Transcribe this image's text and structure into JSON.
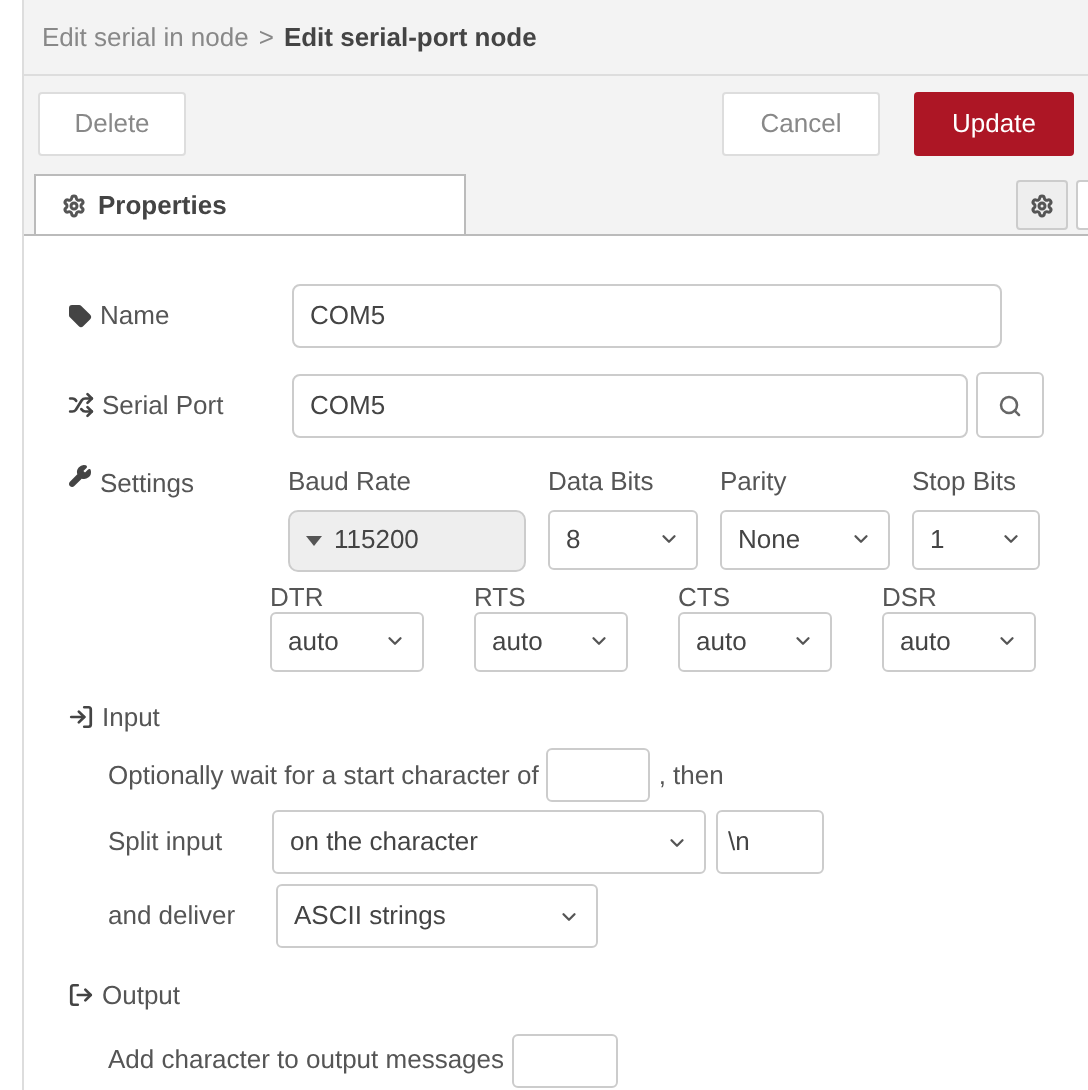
{
  "breadcrumb": {
    "parent": "Edit serial in node",
    "separator": ">",
    "current": "Edit serial-port node"
  },
  "toolbar": {
    "delete": "Delete",
    "cancel": "Cancel",
    "update": "Update"
  },
  "tabs": [
    {
      "label": "Properties",
      "selected": true
    }
  ],
  "name": {
    "label": "Name",
    "value": "COM5"
  },
  "serial_port": {
    "label": "Serial Port",
    "value": "COM5"
  },
  "settings": {
    "label": "Settings",
    "options": [
      {
        "label": "Baud Rate",
        "value": "115200",
        "kind": "combo"
      },
      {
        "label": "Data Bits",
        "value": "8",
        "kind": "select"
      },
      {
        "label": "Parity",
        "value": "None",
        "kind": "select"
      },
      {
        "label": "Stop Bits",
        "value": "1",
        "kind": "select"
      }
    ],
    "lines": [
      {
        "label": "DTR",
        "value": "auto"
      },
      {
        "label": "RTS",
        "value": "auto"
      },
      {
        "label": "CTS",
        "value": "auto"
      },
      {
        "label": "DSR",
        "value": "auto"
      }
    ]
  },
  "input": {
    "title": "Input",
    "start_text": "Optionally wait for a start character of",
    "start_suffix": ", then",
    "split_label": "Split input",
    "split_value": "on the character",
    "split_char": "\\n",
    "deliver_label": "and deliver",
    "deliver_value": "ASCII strings"
  },
  "output": {
    "title": "Output",
    "add_text": "Add character to output messages"
  }
}
